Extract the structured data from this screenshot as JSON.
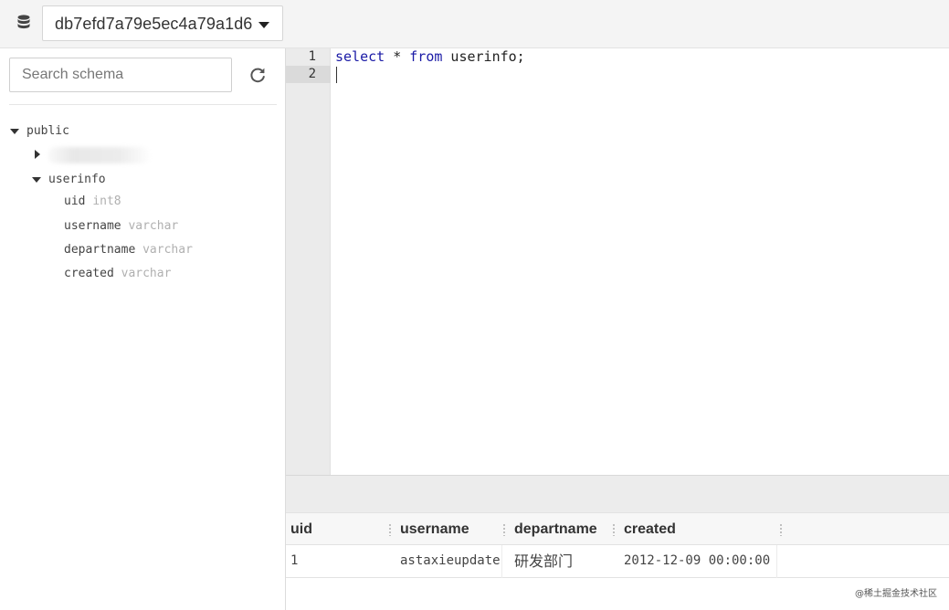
{
  "topbar": {
    "database_name": "db7efd7a79e5ec4a79a1d6",
    "database_icon": "database-icon",
    "dropdown_icon": "caret-down-icon"
  },
  "sidebar": {
    "search_placeholder": "Search schema",
    "refresh_icon": "refresh-icon",
    "schema": {
      "name": "public",
      "tables": [
        {
          "name": "",
          "expanded": false,
          "redacted": true
        },
        {
          "name": "userinfo",
          "expanded": true,
          "columns": [
            {
              "name": "uid",
              "type": "int8"
            },
            {
              "name": "username",
              "type": "varchar"
            },
            {
              "name": "departname",
              "type": "varchar"
            },
            {
              "name": "created",
              "type": "varchar"
            }
          ]
        }
      ]
    }
  },
  "editor": {
    "line_numbers": [
      "1",
      "2"
    ],
    "active_line": 2,
    "code": {
      "kw_select": "select",
      "star": " * ",
      "kw_from": "from",
      "rest": " userinfo;"
    }
  },
  "results": {
    "columns": [
      "uid",
      "username",
      "departname",
      "created"
    ],
    "rows": [
      [
        "1",
        "astaxieupdate",
        "研发部门",
        "2012-12-09 00:00:00"
      ]
    ]
  },
  "watermark": "@稀土掘金技术社区",
  "colors": {
    "keyword": "#1a1aa6",
    "type_hint": "#b0b0b0",
    "gutter_bg": "#ebebeb"
  }
}
